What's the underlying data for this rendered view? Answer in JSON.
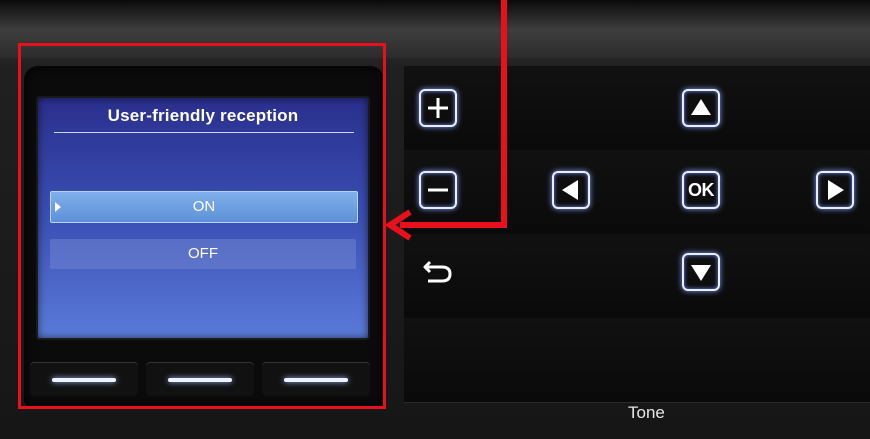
{
  "screen": {
    "title": "User-friendly reception",
    "options": [
      {
        "label": "ON",
        "selected": true
      },
      {
        "label": "OFF",
        "selected": false
      }
    ]
  },
  "soft_keys": [
    "left",
    "middle",
    "right"
  ],
  "keypad": {
    "plus_icon": "plus-icon",
    "minus_icon": "minus-icon",
    "back_icon": "back-icon",
    "up_icon": "arrow-up-icon",
    "down_icon": "arrow-down-icon",
    "left_icon": "arrow-left-icon",
    "right_icon": "arrow-right-icon",
    "ok_label": "OK"
  },
  "tone_label": "Tone",
  "colors": {
    "annotation_red": "#e8101c",
    "lcd_blue": "#2f3a9a",
    "selected_option": "#6f9fe0",
    "key_glow": "#7f9cff"
  }
}
